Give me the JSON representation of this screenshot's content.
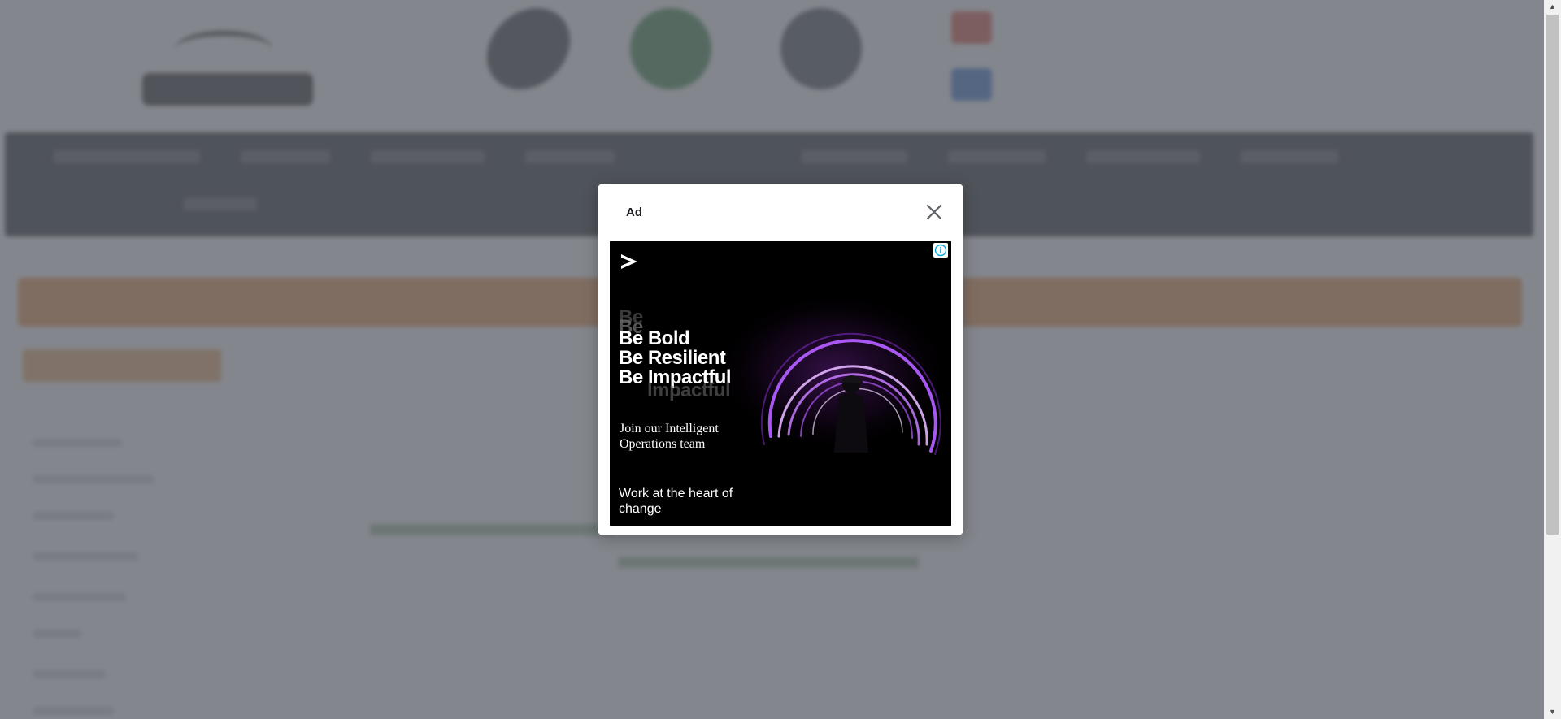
{
  "dialog": {
    "title": "Ad",
    "close_label": "×"
  },
  "ad": {
    "headline_lines": [
      "Be Bold",
      "Be Resilient",
      "Be Impactful"
    ],
    "tagline": "Join our Intelligent Operations team",
    "cta_text": "Work at the heart of change",
    "brand_mark": ">",
    "info_label": "ⓘ"
  },
  "scrollbar": {
    "up_arrow": "▲",
    "down_arrow": "▼"
  },
  "colors": {
    "overlay": "#60646c",
    "accent_purple": "#c77dff",
    "banner_orange": "#f08c3c",
    "info_blue": "#00a9e0"
  },
  "icons": [
    "close-icon",
    "info-icon",
    "brand-arrow-icon",
    "scroll-up-icon",
    "scroll-down-icon"
  ]
}
